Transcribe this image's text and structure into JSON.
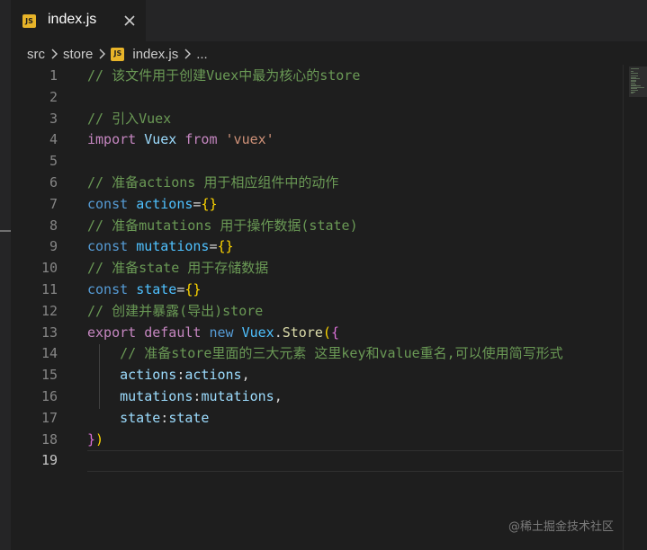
{
  "tab": {
    "icon_text": "JS",
    "title": "index.js",
    "close_icon": "close-icon"
  },
  "breadcrumb": {
    "segments": [
      "src",
      "store"
    ],
    "file_icon_text": "JS",
    "file": "index.js",
    "trailing": "..."
  },
  "editor": {
    "lines": [
      {
        "number": "1",
        "tokens": [
          {
            "t": "// 该文件用于创建Vuex中最为核心的store",
            "c": "cm"
          }
        ]
      },
      {
        "number": "2",
        "tokens": []
      },
      {
        "number": "3",
        "tokens": [
          {
            "t": "// 引入Vuex",
            "c": "cm"
          }
        ]
      },
      {
        "number": "4",
        "tokens": [
          {
            "t": "import",
            "c": "kc"
          },
          {
            "t": " ",
            "c": "op"
          },
          {
            "t": "Vuex",
            "c": "prop"
          },
          {
            "t": " ",
            "c": "op"
          },
          {
            "t": "from",
            "c": "kc"
          },
          {
            "t": " ",
            "c": "op"
          },
          {
            "t": "'vuex'",
            "c": "str"
          }
        ]
      },
      {
        "number": "5",
        "tokens": []
      },
      {
        "number": "6",
        "tokens": [
          {
            "t": "// 准备actions 用于相应组件中的动作",
            "c": "cm"
          }
        ]
      },
      {
        "number": "7",
        "tokens": [
          {
            "t": "const",
            "c": "kw"
          },
          {
            "t": " ",
            "c": "op"
          },
          {
            "t": "actions",
            "c": "var"
          },
          {
            "t": "=",
            "c": "op"
          },
          {
            "t": "{}",
            "c": "br1"
          }
        ]
      },
      {
        "number": "8",
        "tokens": [
          {
            "t": "// 准备mutations 用于操作数据(state)",
            "c": "cm"
          }
        ]
      },
      {
        "number": "9",
        "tokens": [
          {
            "t": "const",
            "c": "kw"
          },
          {
            "t": " ",
            "c": "op"
          },
          {
            "t": "mutations",
            "c": "var"
          },
          {
            "t": "=",
            "c": "op"
          },
          {
            "t": "{}",
            "c": "br1"
          }
        ]
      },
      {
        "number": "10",
        "tokens": [
          {
            "t": "// 准备state 用于存储数据",
            "c": "cm"
          }
        ]
      },
      {
        "number": "11",
        "tokens": [
          {
            "t": "const",
            "c": "kw"
          },
          {
            "t": " ",
            "c": "op"
          },
          {
            "t": "state",
            "c": "var"
          },
          {
            "t": "=",
            "c": "op"
          },
          {
            "t": "{}",
            "c": "br1"
          }
        ]
      },
      {
        "number": "12",
        "tokens": [
          {
            "t": "// 创建并暴露(导出)store",
            "c": "cm"
          }
        ]
      },
      {
        "number": "13",
        "tokens": [
          {
            "t": "export",
            "c": "kc"
          },
          {
            "t": " ",
            "c": "op"
          },
          {
            "t": "default",
            "c": "kc"
          },
          {
            "t": " ",
            "c": "op"
          },
          {
            "t": "new",
            "c": "kw"
          },
          {
            "t": " ",
            "c": "op"
          },
          {
            "t": "Vuex",
            "c": "var"
          },
          {
            "t": ".",
            "c": "op"
          },
          {
            "t": "Store",
            "c": "fn"
          },
          {
            "t": "(",
            "c": "br1"
          },
          {
            "t": "{",
            "c": "br2"
          }
        ]
      },
      {
        "number": "14",
        "tokens": [
          {
            "t": "    // 准备store里面的三大元素 这里key和value重名,可以使用简写形式",
            "c": "cm"
          }
        ]
      },
      {
        "number": "15",
        "tokens": [
          {
            "t": "    ",
            "c": "op"
          },
          {
            "t": "actions",
            "c": "prop"
          },
          {
            "t": ":",
            "c": "op"
          },
          {
            "t": "actions",
            "c": "prop"
          },
          {
            "t": ",",
            "c": "op"
          }
        ]
      },
      {
        "number": "16",
        "tokens": [
          {
            "t": "    ",
            "c": "op"
          },
          {
            "t": "mutations",
            "c": "prop"
          },
          {
            "t": ":",
            "c": "op"
          },
          {
            "t": "mutations",
            "c": "prop"
          },
          {
            "t": ",",
            "c": "op"
          }
        ]
      },
      {
        "number": "17",
        "tokens": [
          {
            "t": "    ",
            "c": "op"
          },
          {
            "t": "state",
            "c": "prop"
          },
          {
            "t": ":",
            "c": "op"
          },
          {
            "t": "state",
            "c": "prop"
          }
        ]
      },
      {
        "number": "18",
        "tokens": [
          {
            "t": "}",
            "c": "br2"
          },
          {
            "t": ")",
            "c": "br1"
          }
        ]
      },
      {
        "number": "19",
        "tokens": []
      }
    ],
    "active_line": "19"
  },
  "colors": {
    "background": "#1e1e1e",
    "comment": "#6a9955",
    "keyword_blue": "#569cd6",
    "keyword_purple": "#c586c0",
    "constant": "#4fc1ff",
    "property": "#9cdcfe",
    "function": "#dcdcaa",
    "string": "#ce9178",
    "bracket_gold": "#ffd700",
    "bracket_pink": "#da70d6",
    "js_badge": "#e8b429"
  },
  "watermark": "@稀土掘金技术社区"
}
